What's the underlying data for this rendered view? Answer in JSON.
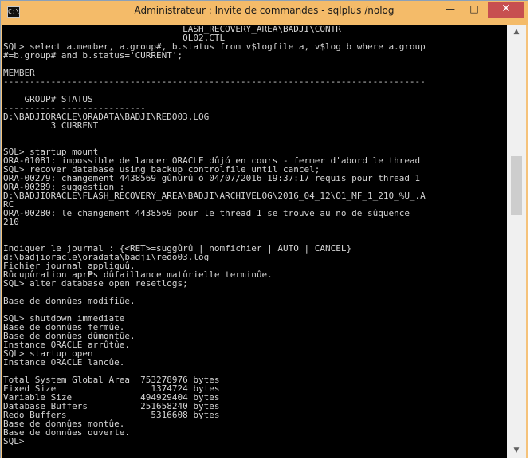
{
  "window": {
    "title": "Administrateur : Invite de commandes - sqlplus  /nolog",
    "app_icon_text": "C:\\",
    "minimize_icon": "minimize-icon",
    "maximize_icon": "maximize-icon",
    "close_icon": "close-icon",
    "minimize_glyph": "—",
    "maximize_glyph": "□",
    "close_glyph": "✕"
  },
  "console": {
    "lines": [
      "                                  LASH_RECOVERY_AREA\\BADJI\\CONTR",
      "                                  OL02.CTL",
      "SQL> select a.member, a.group#, b.status from v$logfile a, v$log b where a.group",
      "#=b.group# and b.status='CURRENT';",
      "",
      "MEMBER",
      "--------------------------------------------------------------------------------",
      "",
      "    GROUP# STATUS",
      "---------- ----------------",
      "D:\\BADJIORACLE\\ORADATA\\BADJI\\REDO03.LOG",
      "         3 CURRENT",
      "",
      "",
      "SQL> startup mount",
      "ORA-01081: impossible de lancer ORACLE dûjó en cours - fermer d'abord le thread",
      "SQL> recover database using backup controlfile until cancel;",
      "ORA-00279: changement 4438569 gûnûrû ó 04/07/2016 19:37:17 requis pour thread 1",
      "ORA-00289: suggestion :",
      "D:\\BADJIORACLE\\FLASH_RECOVERY_AREA\\BADJI\\ARCHIVELOG\\2016_04_12\\O1_MF_1_210_%U_.A",
      "RC",
      "ORA-00280: le changement 4438569 pour le thread 1 se trouve au no de sûquence",
      "210",
      "",
      "",
      "Indiquer le journal : {<RET>=suggûrû | nomfichier | AUTO | CANCEL}",
      "d:\\badjioracle\\oradata\\badji\\redo03.log",
      "Fichier journal appliquû.",
      "Rûcupûration apr₱s dûfaillance matûrielle terminûe.",
      "SQL> alter database open resetlogs;",
      "",
      "Base de donnûes modifiûe.",
      "",
      "SQL> shutdown immediate",
      "Base de donnûes fermûe.",
      "Base de donnûes dûmontûe.",
      "Instance ORACLE arrûtûe.",
      "SQL> startup open",
      "Instance ORACLE lancûe.",
      "",
      "Total System Global Area  753278976 bytes",
      "Fixed Size                  1374724 bytes",
      "Variable Size             494929404 bytes",
      "Database Buffers          251658240 bytes",
      "Redo Buffers                5316608 bytes",
      "Base de donnûes montûe.",
      "Base de donnûes ouverte.",
      "SQL>"
    ]
  },
  "scrollbar": {
    "up_icon": "scroll-up-arrow-icon",
    "down_icon": "scroll-down-arrow-icon",
    "up_glyph": "▲",
    "down_glyph": "▼",
    "position_fraction": 0.34
  },
  "colors": {
    "title_bar": "#f4bb69",
    "close_button": "#c74f50",
    "console_background": "#000000",
    "console_text": "#d3d3d3"
  }
}
